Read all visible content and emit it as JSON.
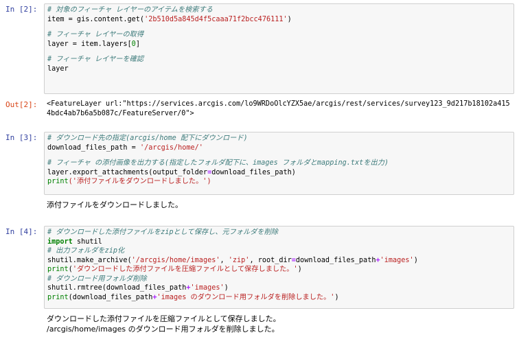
{
  "cells": [
    {
      "prompt": "In [2]:",
      "lines": [
        "# 対象のフィーチャ レイヤーのアイテムを検索する",
        "item = gis.content.get(",
        "'2b510d5a845d4f5caaa71f2bcc476111'",
        ")",
        "# フィーチャ レイヤーの取得",
        "layer = item.layers[",
        "0",
        "]",
        "# フィーチャ レイヤーを確認",
        "layer"
      ],
      "out_prompt": "Out[2]:",
      "out_lines": [
        "<FeatureLayer url:\"https://services.arcgis.com/lo9WRDoOlcYZX5ae/arcgis/rest/services/survey123_9d217b18102a415",
        "4bdc4ab7b6a5b087c/FeatureServer/0\">"
      ]
    },
    {
      "prompt": "In [3]:",
      "lines": [
        "# ダウンロード先の指定(arcgis/home 配下にダウンロード)",
        "download_files_path = ",
        "'/arcgis/home/'",
        "# フィーチャ の添付画像を出力する(指定したフォルダ配下に、images フォルダとmapping.txtを出力)",
        "layer.export_attachments(output_folder",
        "=",
        "download_files_path)",
        "print",
        "('添付ファイルをダウンロードしました。')"
      ],
      "stdout": [
        "添付ファイルをダウンロードしました。"
      ]
    },
    {
      "prompt": "In [4]:",
      "lines": [
        "# ダウンロードした添付ファイルをzipとして保存し、元フォルダを削除",
        "import",
        " shutil",
        "# 出力フォルダをzip化",
        "shutil.make_archive(",
        "'/arcgis/home/images'",
        ", ",
        "'zip'",
        ", root_dir",
        "=",
        "download_files_path",
        "+",
        "'images'",
        ")",
        "print",
        "(",
        "'ダウンロードした添付ファイルを圧縮ファイルとして保存しました。'",
        ")",
        "# ダウンロード用フォルダ削除",
        "shutil.rmtree(download_files_path",
        "+",
        "'images'",
        ")",
        "print",
        "(download_files_path",
        "+",
        "'images のダウンロード用フォルダを削除しました。'",
        ")"
      ],
      "stdout": [
        "ダウンロードした添付ファイルを圧縮ファイルとして保存しました。",
        "/arcgis/home/images のダウンロード用フォルダを削除しました。"
      ]
    }
  ]
}
